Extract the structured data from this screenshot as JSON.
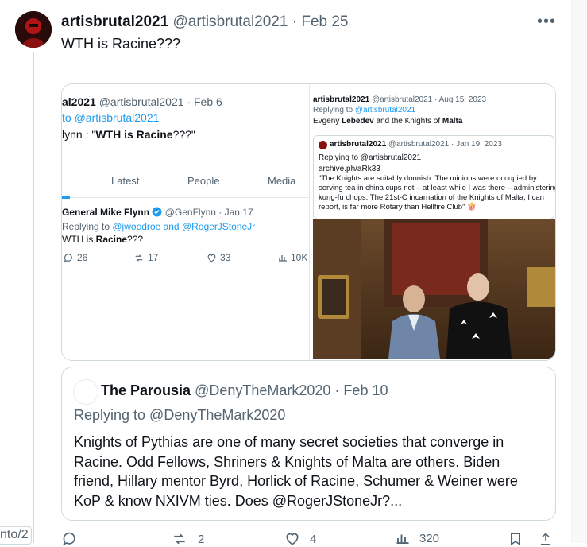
{
  "tweet": {
    "author_name": "artisbrutal2021",
    "handle": "@artisbrutal2021",
    "separator": "·",
    "date": "Feb 25",
    "text": "WTH is Racine???"
  },
  "left_clip_text": "nto/2",
  "media_left": {
    "author_partial": "al2021",
    "handle": "@artisbrutal2021",
    "date": "· Feb 6",
    "reply_prefix": "to ",
    "reply_handle": "@artisbrutal2021",
    "quote_line_prefix": "lynn : \"",
    "quote_line_bold": "WTH is Racine",
    "quote_line_suffix": "???\"",
    "tabs": [
      "Latest",
      "People",
      "Media"
    ],
    "post": {
      "name": "General Mike Flynn",
      "handle": "@GenFlynn",
      "date": "· Jan 17",
      "replying_label": "Replying to ",
      "replying_handles": "@jwoodroe and @RogerJStoneJr",
      "text_prefix": "WTH is ",
      "text_bold": "Racine",
      "text_suffix": "???",
      "replies": "26",
      "reposts": "17",
      "likes": "33",
      "views": "10K"
    }
  },
  "media_right": {
    "author": "artisbrutal2021",
    "handle": "@artisbrutal2021",
    "date": "· Aug 15, 2023",
    "replying_label": "Replying to ",
    "replying_handle": "@artisbrutal2021",
    "line_a": "Evgeny ",
    "line_b": "Lebedev",
    "line_c": " and the Knights of ",
    "line_d": "Malta",
    "inner": {
      "author": "artisbrutal2021",
      "handle": "@artisbrutal2021",
      "date": "· Jan 19, 2023",
      "replying": "Replying to @artisbrutal2021",
      "link": "archive.ph/aRk33",
      "quote_lines": [
        "\"The Knights are suitably donnish..The minions were occupied by",
        "serving tea in china cups not – at least while I was there – administering",
        "kung-fu chops. The 21st-C incarnation of the Knights of Malta, I can",
        "report, is far more Rotary than Hellfire Club\""
      ]
    }
  },
  "quote": {
    "name": "The Parousia",
    "handle": "@DenyTheMark2020",
    "date": "· Feb 10",
    "replying": "Replying to @DenyTheMark2020",
    "body": "Knights of Pythias are one of many secret societies that converge in Racine. Odd Fellows, Shriners & Knights of Malta are others. Biden friend, Hillary mentor Byrd, Horlick of Racine, Schumer & Weiner were KoP & know NXIVM ties. Does @RogerJStoneJr?..."
  },
  "actions": {
    "reposts": "2",
    "likes": "4",
    "views": "320"
  },
  "colors": {
    "link_blue": "#1d9bf0",
    "muted": "#536471",
    "border": "#cfd9de",
    "verified": "#1d9bf0"
  }
}
